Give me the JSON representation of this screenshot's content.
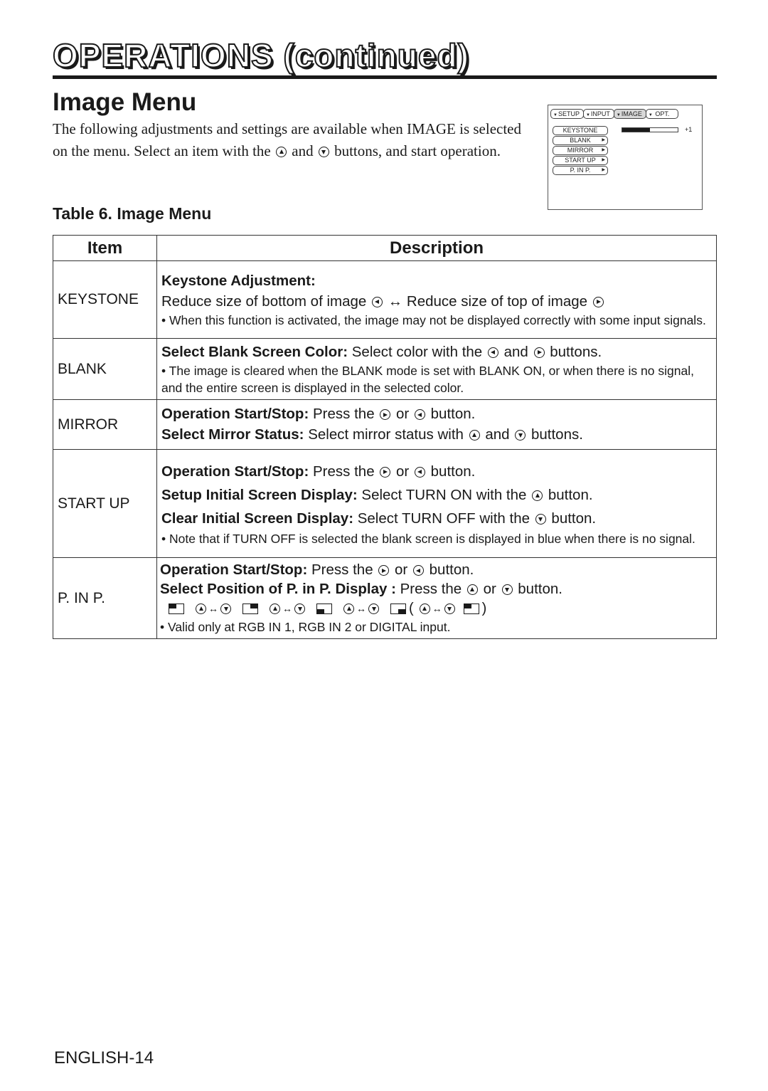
{
  "chapter": {
    "title": "OPERATIONS (continued)"
  },
  "section": {
    "title": "Image Menu"
  },
  "intro": {
    "part1": "The following adjustments and settings are available when IMAGE is selected on the menu. Select an item with the",
    "and": "and",
    "part2": "buttons, and start operation."
  },
  "osd_menu": {
    "tabs": [
      {
        "label": "SETUP",
        "active": false
      },
      {
        "label": "INPUT",
        "active": false
      },
      {
        "label": "IMAGE",
        "active": true
      },
      {
        "label": "OPT.",
        "active": false
      }
    ],
    "items": [
      {
        "label": "KEYSTONE",
        "has_submenu": false
      },
      {
        "label": "BLANK",
        "has_submenu": true
      },
      {
        "label": "MIRROR",
        "has_submenu": true
      },
      {
        "label": "START UP",
        "has_submenu": true
      },
      {
        "label": "P. IN P.",
        "has_submenu": true
      }
    ],
    "keystone_level_fraction": 0.5,
    "keystone_value": "+1"
  },
  "table": {
    "caption": "Table 6. Image Menu",
    "headers": {
      "item": "Item",
      "description": "Description"
    },
    "rows": {
      "keystone": {
        "item": "KEYSTONE",
        "title": "Keystone Adjustment:",
        "reduce_bottom": "Reduce size of bottom of image",
        "arrow": "↔",
        "reduce_top": "Reduce size of top of image",
        "note": "• When this function is activated, the image may not be displayed correctly with some input signals."
      },
      "blank": {
        "item": "BLANK",
        "label": "Select Blank Screen Color:",
        "text1": "Select color with the",
        "and": "and",
        "text2": "buttons.",
        "note": "• The image is cleared when the BLANK mode is set with BLANK ON, or when there is no signal, and the entire screen is displayed in the selected color."
      },
      "mirror": {
        "item": "MIRROR",
        "op_label": "Operation Start/Stop:",
        "op_text1": "Press the",
        "op_or": "or",
        "op_text2": "button.",
        "sel_label": "Select Mirror Status:",
        "sel_text1": "Select mirror status with",
        "sel_and": "and",
        "sel_text2": "buttons."
      },
      "startup": {
        "item": "START UP",
        "op_label": "Operation Start/Stop:",
        "op_text1": "Press the",
        "op_or": "or",
        "op_text2": "button.",
        "setup_label": "Setup Initial Screen Display:",
        "setup_text1": "Select TURN ON with the",
        "setup_text2": "button.",
        "clear_label": "Clear Initial Screen Display:",
        "clear_text1": "Select TURN OFF with the",
        "clear_text2": "button.",
        "note": "• Note that if TURN OFF is selected the blank screen is displayed in blue when there is no signal."
      },
      "pinp": {
        "item": "P. IN P.",
        "op_label": "Operation Start/Stop:",
        "op_text1": "Press the",
        "op_or": "or",
        "op_text2": "button.",
        "sel_label": "Select Position of P. in P. Display :",
        "sel_text1": "Press the",
        "sel_or": "or",
        "sel_text2": "button.",
        "arrow": "↔",
        "paren_open": "(",
        "paren_close": ")",
        "note": "• Valid only at RGB IN 1, RGB IN 2 or DIGITAL input."
      }
    }
  },
  "footer": {
    "page": "ENGLISH-14"
  }
}
